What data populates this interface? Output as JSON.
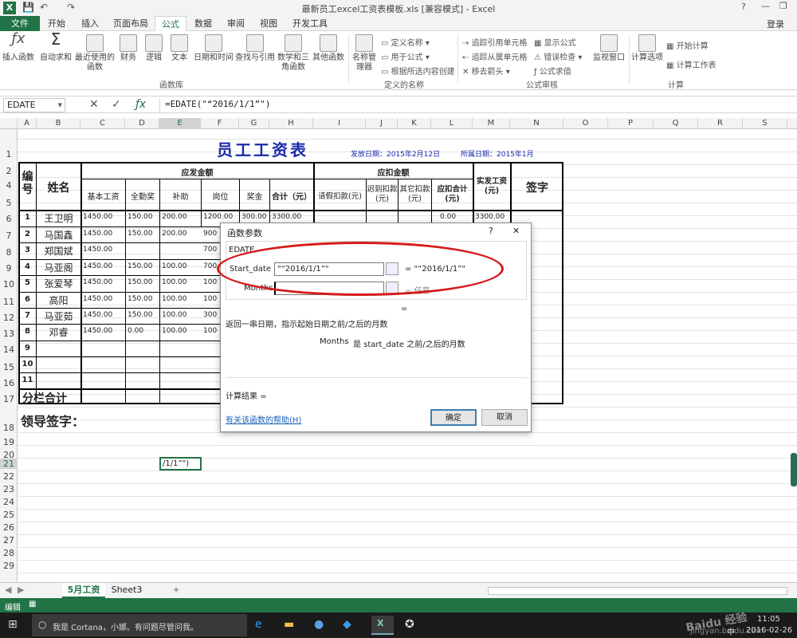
{
  "app": {
    "title": "最新员工excel工资表模板.xls  [兼容模式] - Excel",
    "login": "登录",
    "logo": "X"
  },
  "tabs": {
    "file": "文件",
    "items": [
      "开始",
      "插入",
      "页面布局",
      "公式",
      "数据",
      "审阅",
      "视图",
      "开发工具"
    ],
    "active": "公式"
  },
  "ribbon": {
    "big": [
      "插入函数",
      "自动求和",
      "最近使用的函数",
      "财务",
      "逻辑",
      "文本",
      "日期和时间",
      "查找与引用",
      "数学和三角函数",
      "其他函数",
      "名称管理器"
    ],
    "group_funclib": "函数库",
    "names": [
      "定义名称",
      "用于公式",
      "根据所选内容创建"
    ],
    "group_names": "定义的名称",
    "audit": [
      "追踪引用单元格",
      "追踪从属单元格",
      "移去箭头",
      "显示公式",
      "错误检查",
      "公式求值"
    ],
    "watch": "监视窗口",
    "group_audit": "公式审核",
    "calc_opt": "计算选项",
    "calc": [
      "开始计算",
      "计算工作表"
    ],
    "group_calc": "计算"
  },
  "formula_bar": {
    "name_box": "EDATE",
    "formula": "=EDATE(\"“2016/1/1”\")"
  },
  "columns": [
    "A",
    "B",
    "C",
    "D",
    "E",
    "F",
    "G",
    "H",
    "I",
    "J",
    "K",
    "L",
    "M",
    "N",
    "O",
    "P",
    "Q",
    "R",
    "S"
  ],
  "rows": [
    "1",
    "2",
    "4",
    "5",
    "6",
    "7",
    "8",
    "9",
    "10",
    "11",
    "12",
    "13",
    "14",
    "15",
    "16",
    "17",
    "18",
    "19",
    "20",
    "21",
    "22",
    "23",
    "24",
    "25",
    "26",
    "27",
    "28",
    "29"
  ],
  "sheet": {
    "title": "员工工资表",
    "issue": "发放日期：2015年2月12日",
    "period": "所属日期：2015年1月",
    "h_no": "编号",
    "h_name": "姓名",
    "h_pay": "应发金额",
    "h_ded": "应扣金额",
    "pay_cols": [
      "基本工资",
      "全勤奖",
      "补助",
      "岗位",
      "奖金",
      "合计（元）"
    ],
    "ded_cols": [
      "请假扣款(元)",
      "迟到扣款(元)",
      "其它扣款(元)",
      "应扣合计(元)"
    ],
    "h_net": "实发工资(元)",
    "h_sign": "签字",
    "employees": [
      {
        "no": "1",
        "name": "王卫明",
        "base": "1450.00",
        "att": "150.00",
        "sub": "200.00",
        "post": "1200.00",
        "bonus": "300.00",
        "total": "3300.00",
        "dedtotal": "0.00",
        "net": "3300.00"
      },
      {
        "no": "2",
        "name": "马国鑫",
        "base": "1450.00",
        "att": "150.00",
        "sub": "200.00",
        "post": "900"
      },
      {
        "no": "3",
        "name": "郑国斌",
        "base": "1450.00",
        "att": "",
        "sub": "",
        "post": "700"
      },
      {
        "no": "4",
        "name": "马亚阁",
        "base": "1450.00",
        "att": "150.00",
        "sub": "100.00",
        "post": "700"
      },
      {
        "no": "5",
        "name": "张爱琴",
        "base": "1450.00",
        "att": "150.00",
        "sub": "100.00",
        "post": "100"
      },
      {
        "no": "6",
        "name": "高阳",
        "base": "1450.00",
        "att": "150.00",
        "sub": "100.00",
        "post": "100"
      },
      {
        "no": "7",
        "name": "马亚茹",
        "base": "1450.00",
        "att": "150.00",
        "sub": "100.00",
        "post": "300"
      },
      {
        "no": "8",
        "name": "邓睿",
        "base": "1450.00",
        "att": "0.00",
        "sub": "100.00",
        "post": "100"
      }
    ],
    "empty_nos": [
      "9",
      "10",
      "11"
    ],
    "subtotal": "分栏合计",
    "leader": "领导签字：",
    "active_cell": "/1/1”\")"
  },
  "dialog": {
    "title": "函数参数",
    "help_q": "?",
    "close": "✕",
    "fn": "EDATE",
    "arg1_label": "Start_date",
    "arg1_value": "\"“2016/1/1”\"",
    "arg1_result": "= \"“2016/1/1”\"",
    "arg2_label": "Months",
    "arg2_value": "",
    "arg2_result": "= 任意",
    "eq": "=",
    "desc": "返回一串日期，指示起始日期之前/之后的月数",
    "arg_desc_name": "Months",
    "arg_desc": "是 start_date 之前/之后的月数",
    "result": "计算结果 =",
    "help": "有关该函数的帮助(H)",
    "ok": "确定",
    "cancel": "取消"
  },
  "sheet_tabs": [
    "5月工资",
    "Sheet3"
  ],
  "add_sheet": "+",
  "status": {
    "mode": "编辑"
  },
  "taskbar": {
    "cortana": "我是 Cortana，小娜。有问题尽管问我。",
    "time": "11:05",
    "date": "2016-02-26",
    "ime": "中",
    "watermark": "Baidu 经验",
    "watermark_url": "jingyan.baidu.com"
  },
  "accent": "#217346"
}
